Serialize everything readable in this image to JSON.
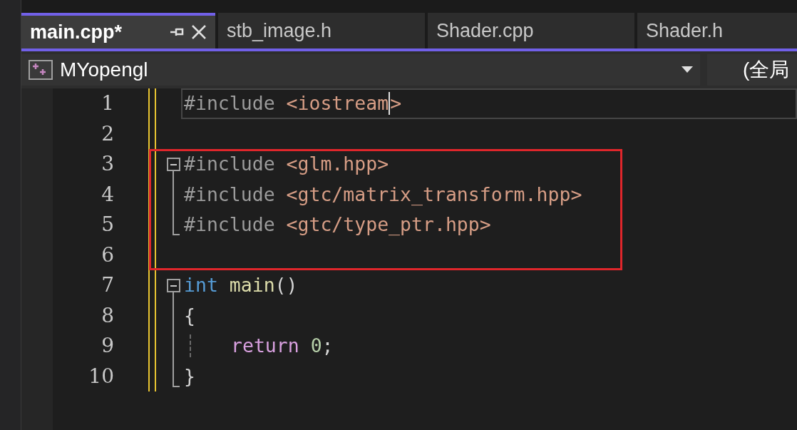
{
  "tabs": [
    {
      "label": "main.cpp*",
      "selected": true,
      "pinned": true
    },
    {
      "label": "stb_image.h",
      "selected": false,
      "pinned": false
    },
    {
      "label": "Shader.cpp",
      "selected": false,
      "pinned": false
    },
    {
      "label": "Shader.h",
      "selected": false,
      "pinned": false
    }
  ],
  "navigation": {
    "project": "MYopengl",
    "scope": "(全局"
  },
  "lines": [
    {
      "number": "1",
      "current": true,
      "changed": true,
      "highlight": false,
      "kind": "plain",
      "tokens": [
        {
          "kind": "pre",
          "text": "#include"
        },
        {
          "kind": "gap"
        },
        {
          "kind": "path",
          "text": "<iostream"
        },
        {
          "kind": "caret"
        },
        {
          "kind": "path",
          "text": ">"
        }
      ]
    },
    {
      "number": "2",
      "current": false,
      "changed": true,
      "highlight": false,
      "kind": "plain"
    },
    {
      "number": "3",
      "current": false,
      "changed": true,
      "highlight": true,
      "kind": "fold",
      "tokens": [
        {
          "kind": "pre",
          "text": "#include"
        },
        {
          "kind": "gap"
        },
        {
          "kind": "path",
          "text": "<glm.hpp>"
        }
      ]
    },
    {
      "number": "4",
      "current": false,
      "changed": true,
      "highlight": true,
      "kind": "inner",
      "tokens": [
        {
          "kind": "pre",
          "text": "#include"
        },
        {
          "kind": "gap"
        },
        {
          "kind": "path",
          "text": "<gtc/matrix_transform.hpp>"
        }
      ]
    },
    {
      "number": "5",
      "current": false,
      "changed": true,
      "highlight": true,
      "kind": "last",
      "tokens": [
        {
          "kind": "pre",
          "text": "#include"
        },
        {
          "kind": "gap"
        },
        {
          "kind": "path",
          "text": "<gtc/type_ptr.hpp>"
        }
      ]
    },
    {
      "number": "6",
      "current": false,
      "changed": true,
      "highlight": true,
      "kind": "plain"
    },
    {
      "number": "7",
      "current": false,
      "changed": true,
      "highlight": false,
      "kind": "fold",
      "tokens": [
        {
          "kind": "keyword",
          "text": "int"
        },
        {
          "kind": "gap"
        },
        {
          "kind": "function",
          "text": "main"
        },
        {
          "kind": "plain",
          "text": "()"
        }
      ]
    },
    {
      "number": "8",
      "current": false,
      "changed": true,
      "highlight": false,
      "kind": "inner",
      "tokens": [
        {
          "kind": "plain",
          "text": "{"
        }
      ]
    },
    {
      "number": "9",
      "current": false,
      "changed": true,
      "highlight": false,
      "kind": "inner",
      "tokens": [
        {
          "kind": "indent"
        },
        {
          "kind": "control",
          "text": "return"
        },
        {
          "kind": "gap"
        },
        {
          "kind": "number",
          "text": "0"
        },
        {
          "kind": "plain",
          "text": ";"
        }
      ]
    },
    {
      "number": "10",
      "current": false,
      "changed": true,
      "highlight": false,
      "kind": "last",
      "tokens": [
        {
          "kind": "plain",
          "text": "}"
        }
      ]
    }
  ]
}
